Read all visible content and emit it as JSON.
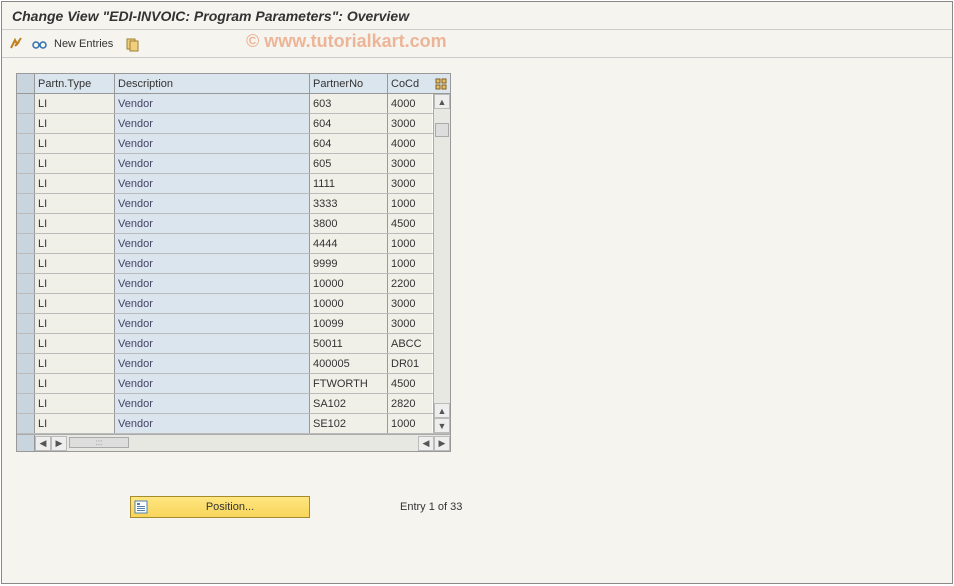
{
  "title": "Change View \"EDI-INVOIC: Program Parameters\": Overview",
  "watermark": "© www.tutorialkart.com",
  "toolbar": {
    "new_entries_label": "New Entries"
  },
  "table": {
    "headers": {
      "partn_type": "Partn.Type",
      "description": "Description",
      "partner_no": "PartnerNo",
      "cocd": "CoCd"
    },
    "rows": [
      {
        "type": "LI",
        "desc": "Vendor",
        "partner": "603",
        "cocd": "4000"
      },
      {
        "type": "LI",
        "desc": "Vendor",
        "partner": "604",
        "cocd": "3000"
      },
      {
        "type": "LI",
        "desc": "Vendor",
        "partner": "604",
        "cocd": "4000"
      },
      {
        "type": "LI",
        "desc": "Vendor",
        "partner": "605",
        "cocd": "3000"
      },
      {
        "type": "LI",
        "desc": "Vendor",
        "partner": "1111",
        "cocd": "3000"
      },
      {
        "type": "LI",
        "desc": "Vendor",
        "partner": "3333",
        "cocd": "1000"
      },
      {
        "type": "LI",
        "desc": "Vendor",
        "partner": "3800",
        "cocd": "4500"
      },
      {
        "type": "LI",
        "desc": "Vendor",
        "partner": "4444",
        "cocd": "1000"
      },
      {
        "type": "LI",
        "desc": "Vendor",
        "partner": "9999",
        "cocd": "1000"
      },
      {
        "type": "LI",
        "desc": "Vendor",
        "partner": "10000",
        "cocd": "2200"
      },
      {
        "type": "LI",
        "desc": "Vendor",
        "partner": "10000",
        "cocd": "3000"
      },
      {
        "type": "LI",
        "desc": "Vendor",
        "partner": "10099",
        "cocd": "3000"
      },
      {
        "type": "LI",
        "desc": "Vendor",
        "partner": "50011",
        "cocd": "ABCC"
      },
      {
        "type": "LI",
        "desc": "Vendor",
        "partner": "400005",
        "cocd": "DR01"
      },
      {
        "type": "LI",
        "desc": "Vendor",
        "partner": "FTWORTH",
        "cocd": "4500"
      },
      {
        "type": "LI",
        "desc": "Vendor",
        "partner": "SA102",
        "cocd": "2820"
      },
      {
        "type": "LI",
        "desc": "Vendor",
        "partner": "SE102",
        "cocd": "1000"
      }
    ]
  },
  "footer": {
    "position_label": "Position...",
    "entry_text": "Entry 1 of 33"
  }
}
